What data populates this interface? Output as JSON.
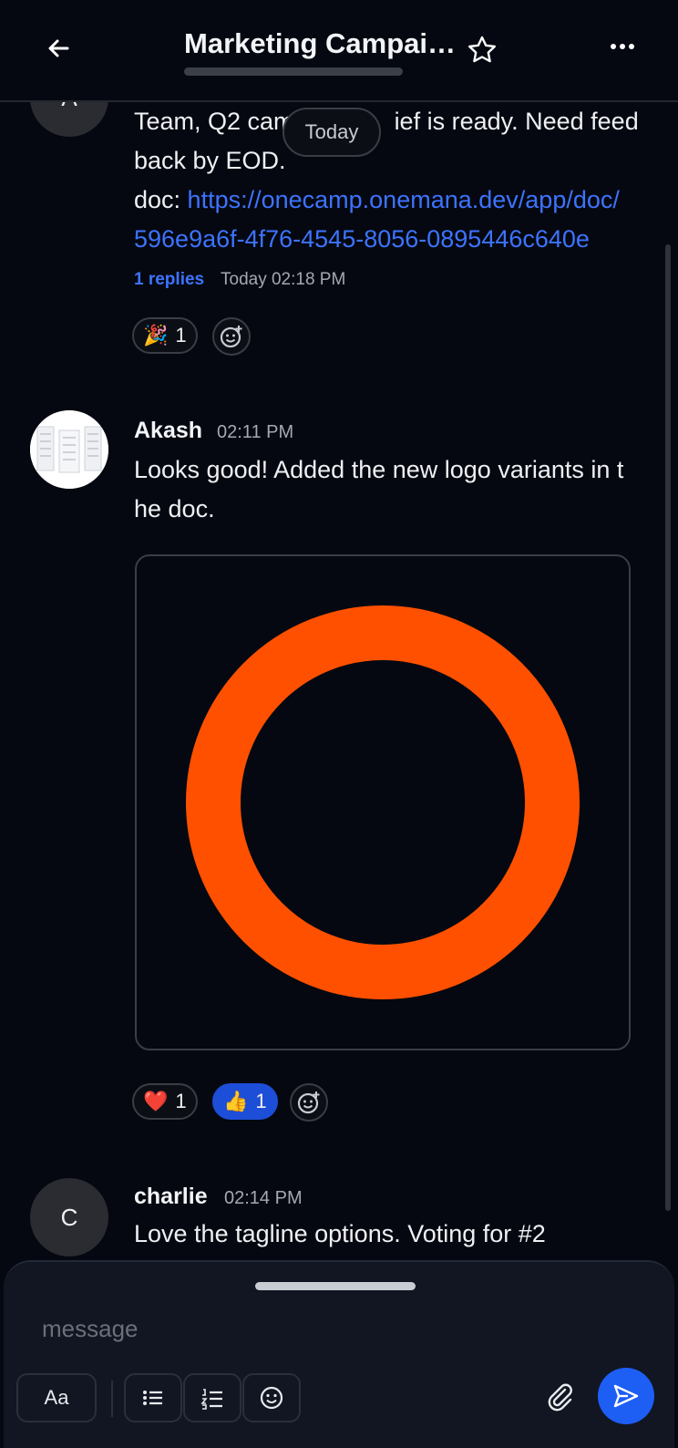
{
  "header": {
    "title": "Marketing Campai…"
  },
  "today_label": "Today",
  "messages": [
    {
      "avatar_initial": "A",
      "text_line1": "Team, Q2 cam",
      "text_line1_tail": "ief is ready. Need feed",
      "text_line2": "back by EOD.",
      "doc_prefix": "doc: ",
      "doc_link_line1": "https://onecamp.onemana.dev/app/doc/",
      "doc_link_line2": "596e9a6f-4f76-4545-8056-0895446c640e",
      "replies": "1 replies",
      "reply_time": "Today 02:18 PM",
      "reactions": [
        {
          "emoji": "🎉",
          "count": "1"
        }
      ]
    },
    {
      "name": "Akash",
      "time": "02:11 PM",
      "text_line1": "Looks good! Added the new logo variants in t",
      "text_line2": "he doc.",
      "image_ring_color": "#ff5000",
      "reactions": [
        {
          "emoji": "❤️",
          "count": "1"
        },
        {
          "emoji": "👍",
          "count": "1"
        }
      ]
    },
    {
      "avatar_initial": "C",
      "name": "charlie",
      "time": "02:14 PM",
      "text_line1": "Love the tagline options. Voting for #2"
    }
  ],
  "composer": {
    "placeholder": "message",
    "format_label": "Aa"
  },
  "colors": {
    "accent": "#1d5ef5",
    "link": "#3d73ff",
    "background": "#050810"
  }
}
